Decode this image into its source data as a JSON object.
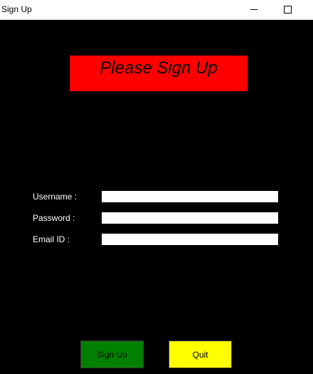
{
  "window": {
    "title": "Sign Up"
  },
  "form": {
    "heading": "Please Sign Up",
    "fields": [
      {
        "label": "Username :",
        "value": ""
      },
      {
        "label": "Password :",
        "value": ""
      },
      {
        "label": "Email ID :",
        "value": ""
      }
    ]
  },
  "buttons": {
    "signup_label": "Sign Up",
    "quit_label": "Quit"
  },
  "icons": {
    "minimize": "minimize-icon",
    "maximize": "maximize-icon"
  },
  "colors": {
    "background": "#000000",
    "heading_bg": "#ff0000",
    "signup_bg": "#008000",
    "quit_bg": "#ffff00",
    "label_text": "#ffffff"
  }
}
